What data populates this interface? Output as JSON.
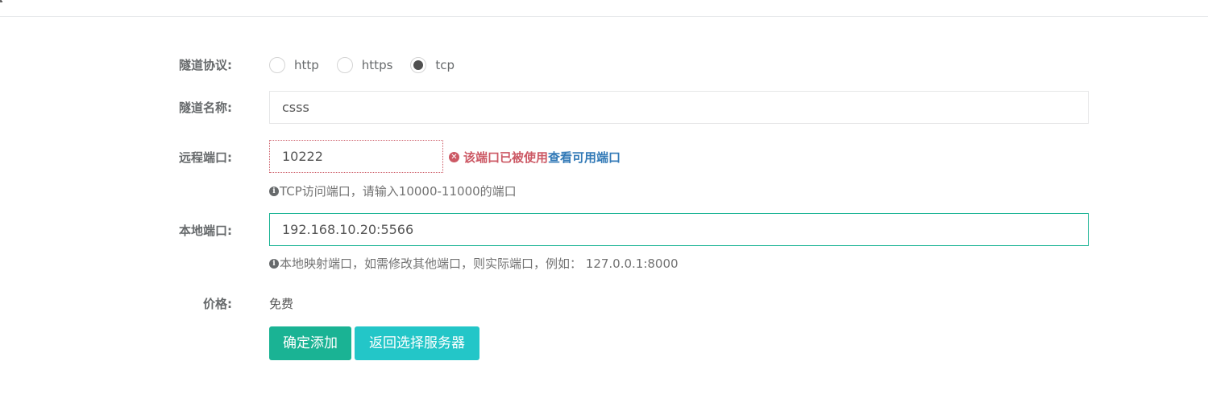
{
  "form": {
    "protocol": {
      "label": "隧道协议:",
      "options": [
        {
          "label": "http",
          "checked": false
        },
        {
          "label": "https",
          "checked": false
        },
        {
          "label": "tcp",
          "checked": true
        }
      ]
    },
    "tunnel_name": {
      "label": "隧道名称:",
      "value": "csss"
    },
    "remote_port": {
      "label": "远程端口:",
      "value": "10222",
      "error_icon": "x-circle-icon",
      "error_text": "该端口已被使用",
      "error_link": "查看可用端口",
      "help_icon": "info-icon",
      "help_text": "TCP访问端口，请输入10000-11000的端口"
    },
    "local_port": {
      "label": "本地端口:",
      "value": "192.168.10.20:5566",
      "help_icon": "info-icon",
      "help_text": "本地映射端口，如需修改其他端口，则实际端口，例如： 127.0.0.1:8000"
    },
    "price": {
      "label": "价格:",
      "value": "免费"
    },
    "buttons": {
      "confirm": "确定添加",
      "back": "返回选择服务器"
    }
  },
  "colors": {
    "primary": "#1ab394",
    "info": "#23c6c8",
    "error": "#cc5965",
    "link": "#337ab7"
  }
}
